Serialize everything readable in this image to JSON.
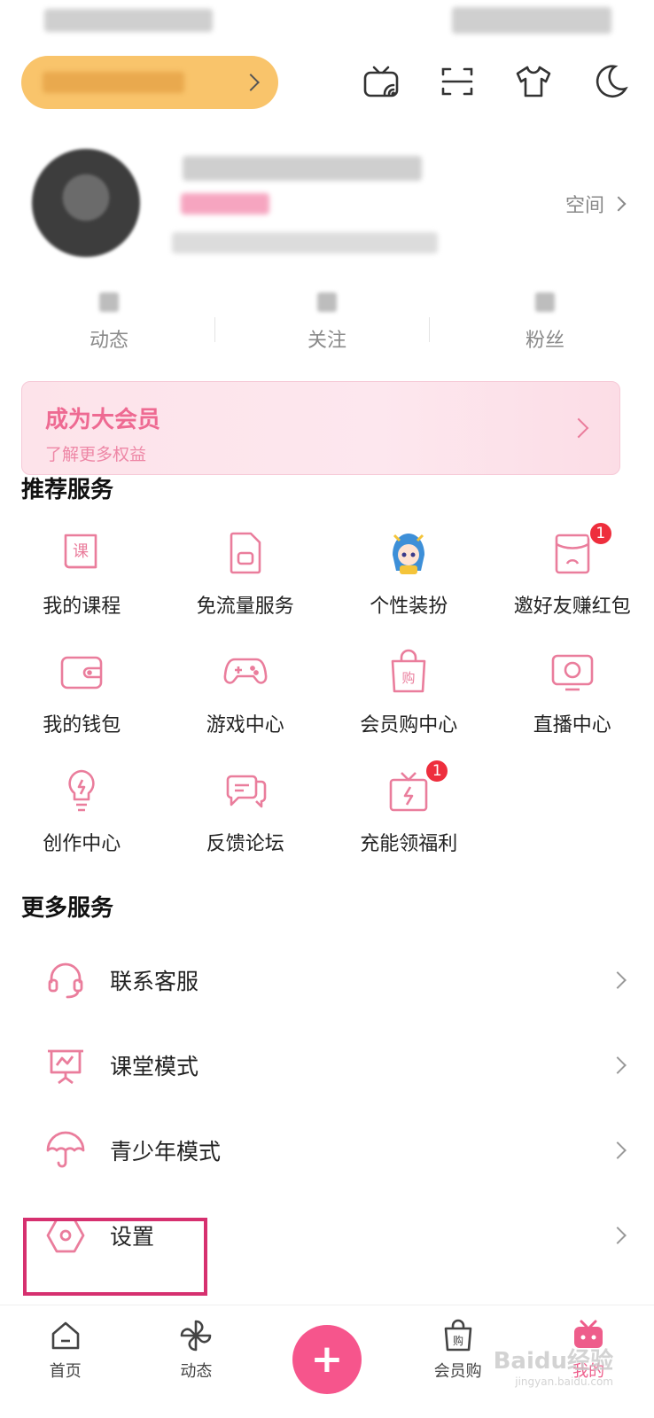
{
  "profile": {
    "space_label": "空间"
  },
  "stats": [
    {
      "label": "动态"
    },
    {
      "label": "关注"
    },
    {
      "label": "粉丝"
    }
  ],
  "vip_banner": {
    "title": "成为大会员",
    "subtitle": "了解更多权益"
  },
  "recommended": {
    "title": "推荐服务",
    "items": [
      {
        "label": "我的课程",
        "icon": "course-book-icon"
      },
      {
        "label": "免流量服务",
        "icon": "sim-card-icon"
      },
      {
        "label": "个性装扮",
        "icon": "anime-character-icon"
      },
      {
        "label": "邀好友赚红包",
        "icon": "red-envelope-icon",
        "badge": "1"
      },
      {
        "label": "我的钱包",
        "icon": "wallet-icon"
      },
      {
        "label": "游戏中心",
        "icon": "gamepad-icon"
      },
      {
        "label": "会员购中心",
        "icon": "shopping-bag-icon"
      },
      {
        "label": "直播中心",
        "icon": "tv-icon"
      },
      {
        "label": "创作中心",
        "icon": "lightbulb-icon"
      },
      {
        "label": "反馈论坛",
        "icon": "chat-bubbles-icon"
      },
      {
        "label": "充能领福利",
        "icon": "gift-lightning-icon",
        "badge": "1"
      }
    ]
  },
  "more": {
    "title": "更多服务",
    "items": [
      {
        "label": "联系客服",
        "icon": "headset-icon"
      },
      {
        "label": "课堂模式",
        "icon": "blackboard-icon"
      },
      {
        "label": "青少年模式",
        "icon": "umbrella-icon"
      },
      {
        "label": "设置",
        "icon": "settings-hexagon-icon"
      }
    ]
  },
  "bottom_nav": [
    {
      "label": "首页",
      "icon": "home-icon"
    },
    {
      "label": "动态",
      "icon": "pinwheel-icon"
    },
    {
      "label": "",
      "icon": "plus-icon"
    },
    {
      "label": "会员购",
      "icon": "shopping-bag-icon"
    },
    {
      "label": "我的",
      "icon": "tv-mascot-icon",
      "active": true
    }
  ],
  "watermark": {
    "text": "Baidu经验",
    "sub": "jingyan.baidu.com"
  },
  "colors": {
    "accent": "#f6558c",
    "icon_pink": "#ea7d9c",
    "vip_gold": "#f9c46b",
    "highlight_box": "#d6306f",
    "badge_red": "#ee2e3d"
  }
}
